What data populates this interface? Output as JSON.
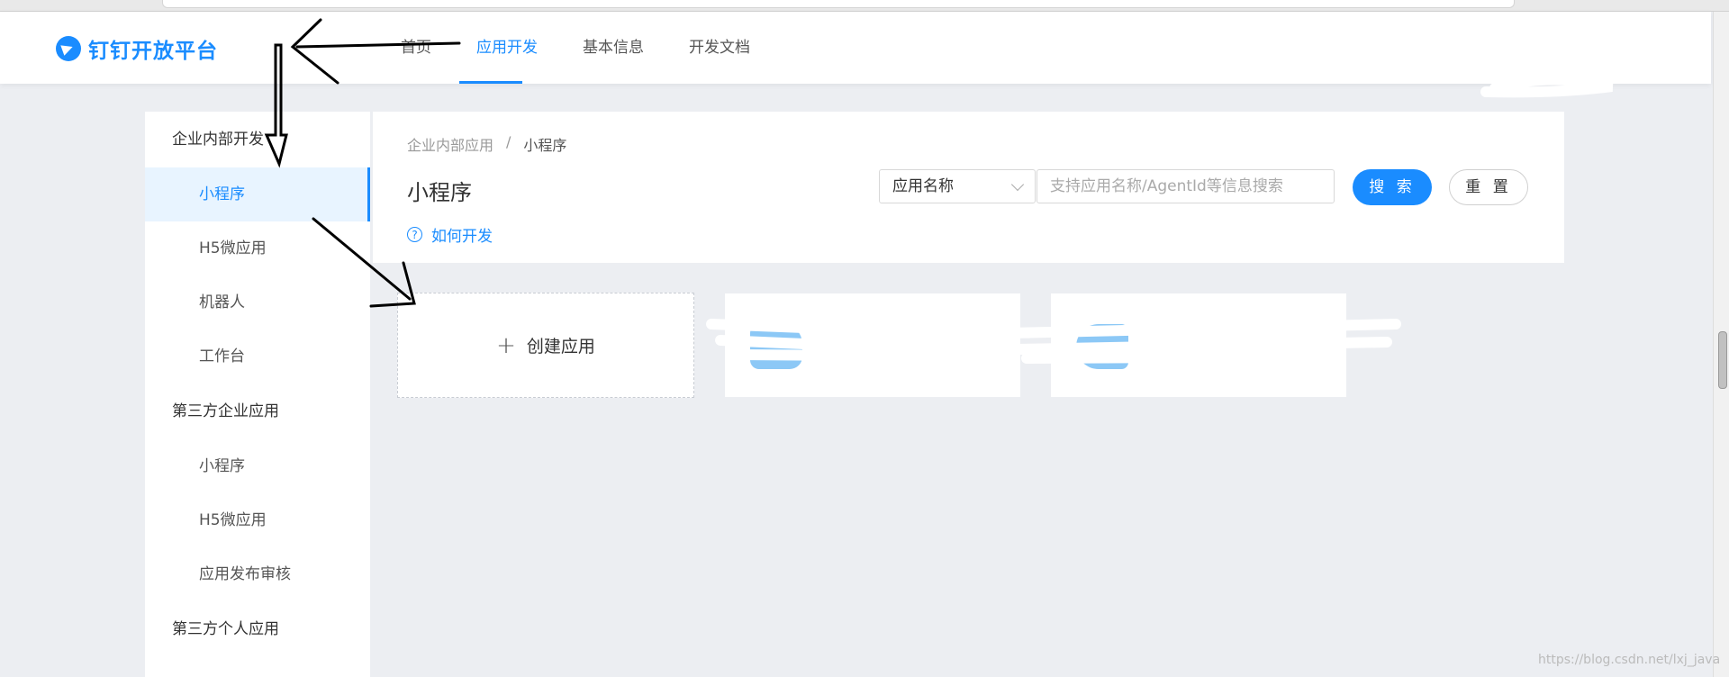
{
  "header": {
    "logo_text": "钉钉开放平台",
    "nav": [
      "首页",
      "应用开发",
      "基本信息",
      "开发文档"
    ],
    "active_nav": "应用开发"
  },
  "sidebar": {
    "groups": [
      {
        "title": "企业内部开发",
        "items": [
          "小程序",
          "H5微应用",
          "机器人",
          "工作台"
        ]
      },
      {
        "title": "第三方企业应用",
        "items": [
          "小程序",
          "H5微应用",
          "应用发布审核"
        ]
      },
      {
        "title": "第三方个人应用",
        "items": []
      }
    ],
    "active_item": "小程序"
  },
  "content": {
    "breadcrumb": [
      "企业内部应用",
      "/",
      "小程序"
    ],
    "title": "小程序",
    "how_to_dev": "如何开发",
    "select_value": "应用名称",
    "search_placeholder": "支持应用名称/AgentId等信息搜索",
    "search_button": "搜 索",
    "reset_button": "重 置",
    "create_app": "创建应用"
  },
  "watermark": "https://blog.csdn.net/lxj_java",
  "colors": {
    "accent": "#1a8cff",
    "background": "#eceef2"
  }
}
